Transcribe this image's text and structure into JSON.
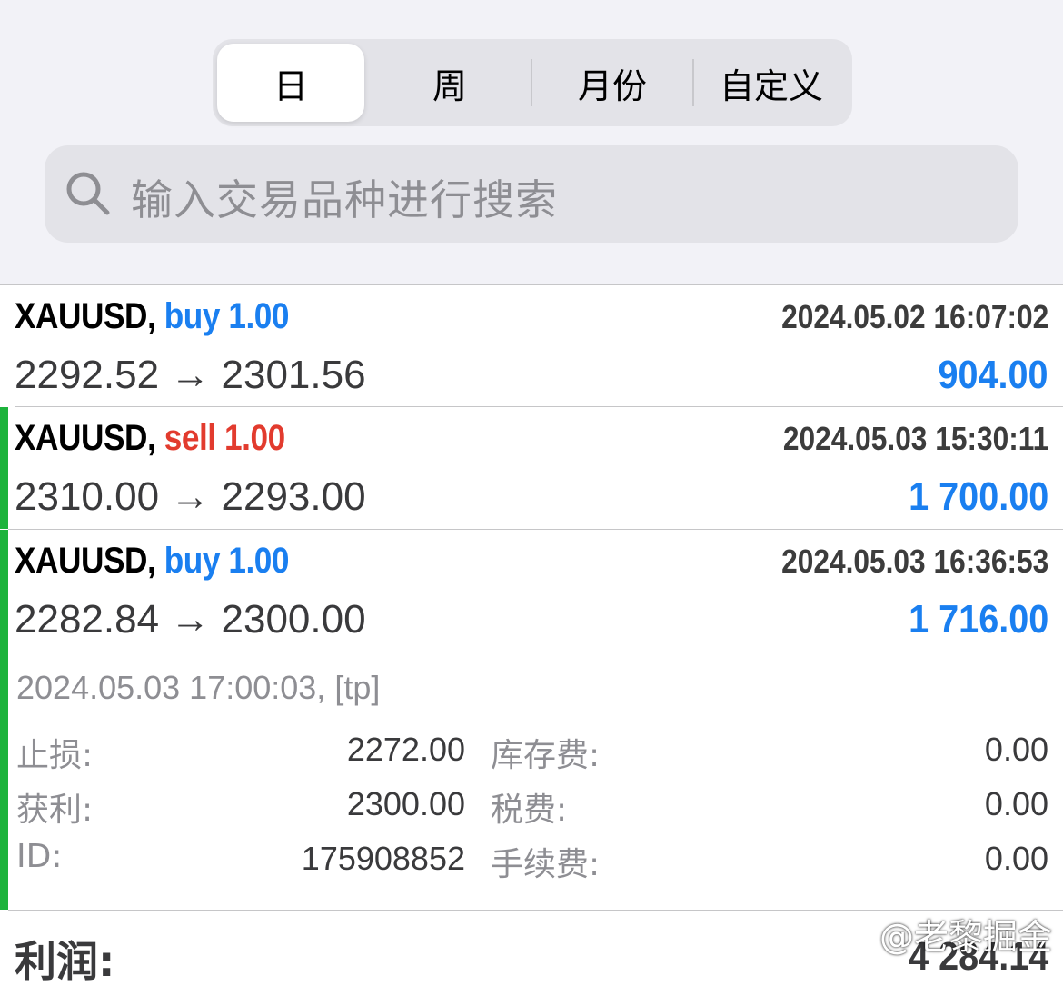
{
  "period_tabs": [
    {
      "label": "日",
      "active": true
    },
    {
      "label": "周",
      "active": false
    },
    {
      "label": "月份",
      "active": false
    },
    {
      "label": "自定义",
      "active": false
    }
  ],
  "search": {
    "placeholder": "输入交易品种进行搜索",
    "icon": "search-icon"
  },
  "trades": [
    {
      "symbol": "XAUUSD,",
      "direction": "buy",
      "lots": "1.00",
      "time": "2024.05.02 16:07:02",
      "prices": "2292.52 → 2301.56",
      "profit": "904.00"
    },
    {
      "symbol": "XAUUSD,",
      "direction": "sell",
      "lots": "1.00",
      "time": "2024.05.03 15:30:11",
      "prices": "2310.00 → 2293.00",
      "profit": "1 700.00"
    },
    {
      "symbol": "XAUUSD,",
      "direction": "buy",
      "lots": "1.00",
      "time": "2024.05.03 16:36:53",
      "prices": "2282.84 → 2300.00",
      "profit": "1 716.00"
    }
  ],
  "expanded": {
    "close_info": "2024.05.03 17:00:03, [tp]",
    "sl_label": "止损:",
    "sl_value": "2272.00",
    "tp_label": "获利:",
    "tp_value": "2300.00",
    "id_label": "ID:",
    "id_value": "175908852",
    "swap_label": "库存费:",
    "swap_value": "0.00",
    "tax_label": "税费:",
    "tax_value": "0.00",
    "commission_label": "手续费:",
    "commission_value": "0.00"
  },
  "summary": {
    "label": "利润:",
    "value": "4 284.14"
  },
  "watermark": "@老黎掘金",
  "colors": {
    "buy": "#1a7ff0",
    "sell": "#e23b2e",
    "tp": "#1aad32",
    "accent": "#1db33c"
  }
}
